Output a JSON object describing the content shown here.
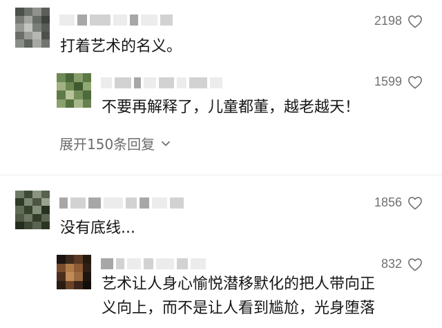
{
  "comments": [
    {
      "likes": "2198",
      "text": "打着艺术的名义。",
      "reply": {
        "likes": "1599",
        "text": "不要再解释了，儿童都董，越老越天！"
      },
      "expand_label": "展开150条回复"
    },
    {
      "likes": "1856",
      "text": "没有底线...",
      "reply": {
        "likes": "832",
        "text_lines": [
          "艺术让人身心愉悦潜移默化的把人带向正",
          "义向上，而不是让人看到尴尬，光身堕落"
        ]
      }
    }
  ],
  "icons": {
    "like": "heart-outline-icon",
    "expand": "chevron-down-icon"
  },
  "colors": {
    "text": "#161616",
    "muted": "#707070"
  }
}
